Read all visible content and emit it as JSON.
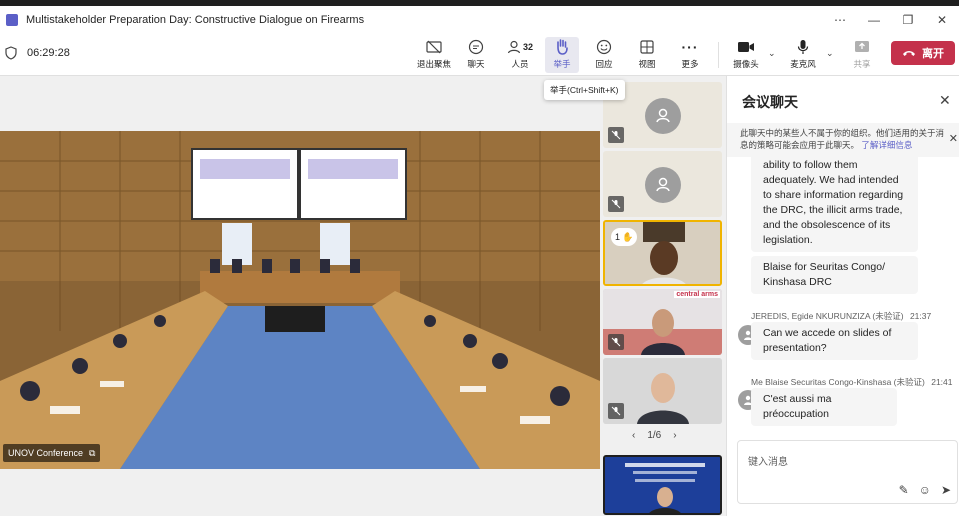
{
  "window": {
    "title": "Multistakeholder Preparation Day: Constructive Dialogue on Firearms",
    "controls": [
      "⋯",
      "—",
      "❐",
      "✕"
    ]
  },
  "toolbar": {
    "timer": "06:29:28",
    "buttons": {
      "exit_focus": "退出聚焦",
      "chat": "聊天",
      "people": "人员",
      "people_count": "32",
      "raise_hand": "举手",
      "react": "回应",
      "view": "视图",
      "more": "更多",
      "camera": "摄像头",
      "mic": "麦克风",
      "share": "共享"
    },
    "leave": "离开",
    "tooltip": "举手(Ctrl+Shift+K)"
  },
  "stage": {
    "presenter_name": "UNOV Conference"
  },
  "rail": {
    "raised_hand_count": "1",
    "tile_logo": "central arms",
    "pager": "1/6"
  },
  "chat": {
    "title": "会议聊天",
    "banner": "此聊天中的某些人不属于你的组织。他们适用的关于消息的策略可能会应用于此聊天。",
    "banner_link": "了解详细信息",
    "messages": [
      {
        "text": "ability to follow them adequately. We had intended to share information regarding the DRC, the illicit arms trade, and the obsolescence of its legislation."
      },
      {
        "text": "Blaise for Seuritas Congo/ Kinshasa DRC"
      },
      {
        "sender": "JEREDIS, Egide NKURUNZIZA (未验证)",
        "time": "21:37",
        "text": "Can we accede on slides of presentation?"
      },
      {
        "sender": "Me Blaise Securitas Congo-Kinshasa (未验证)",
        "time": "21:41",
        "text": "C'est aussi ma préoccupation"
      }
    ],
    "composer_placeholder": "键入消息"
  },
  "colors": {
    "accent": "#5b5fc7",
    "leave": "#c4314b",
    "raised_hand": "#f0b400"
  }
}
